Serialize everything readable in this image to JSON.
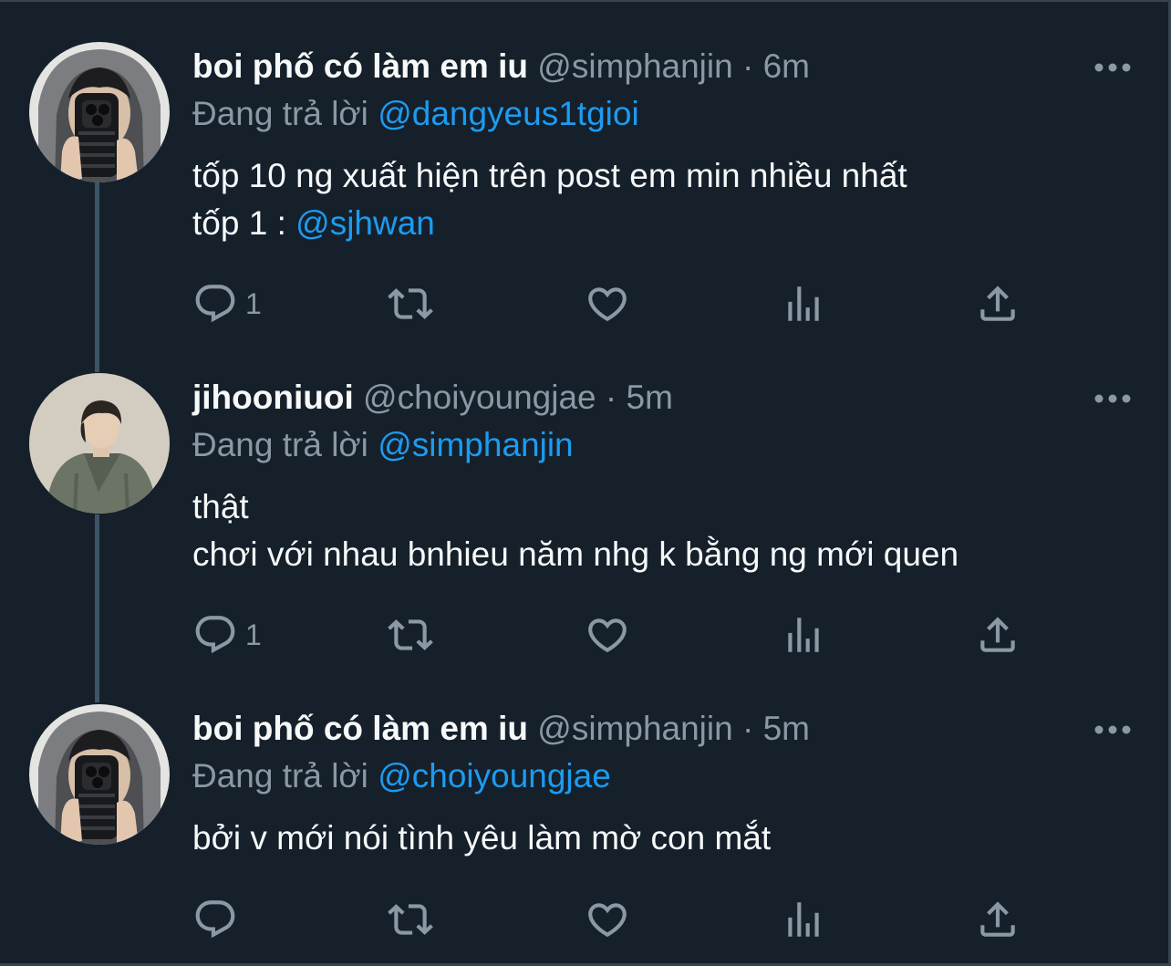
{
  "tweets": [
    {
      "name": "boi phố có làm em iu",
      "handle": "@simphanjin",
      "separator": "·",
      "time": "6m",
      "reply_prefix": "Đang trả lời",
      "reply_to": "@dangyeus1tgioi",
      "lines": [
        {
          "text": "tốp 10 ng xuất hiện trên post em min nhiều nhất",
          "mention": ""
        },
        {
          "text": "tốp 1 : ",
          "mention": "@sjhwan"
        }
      ],
      "reply_count": "1",
      "avatar": "avatar-man-hoodie-phone-selfie"
    },
    {
      "name": "jihooniuoi",
      "handle": "@choiyoungjae",
      "separator": "·",
      "time": "5m",
      "reply_prefix": "Đang trả lời",
      "reply_to": "@simphanjin",
      "lines": [
        {
          "text": "thật",
          "mention": ""
        },
        {
          "text": "chơi với nhau bnhieu năm nhg k bằng ng mới quen",
          "mention": ""
        }
      ],
      "reply_count": "1",
      "avatar": "avatar-man-green-jacket"
    },
    {
      "name": "boi phố có làm em iu",
      "handle": "@simphanjin",
      "separator": "·",
      "time": "5m",
      "reply_prefix": "Đang trả lời",
      "reply_to": "@choiyoungjae",
      "lines": [
        {
          "text": "bởi v mới nói tình yêu làm mờ con mắt",
          "mention": ""
        }
      ],
      "reply_count": "",
      "avatar": "avatar-man-hoodie-phone-selfie"
    }
  ],
  "icons": {
    "reply": "speech-bubble-icon",
    "retweet": "retweet-icon",
    "like": "heart-icon",
    "views": "analytics-icon",
    "share": "share-icon",
    "more": "more-dots-icon"
  },
  "colors": {
    "background": "#15202b",
    "text": "#f7f9f9",
    "secondary": "#8b98a5",
    "accent": "#1d9bf0",
    "thread_line": "#3d5466"
  }
}
